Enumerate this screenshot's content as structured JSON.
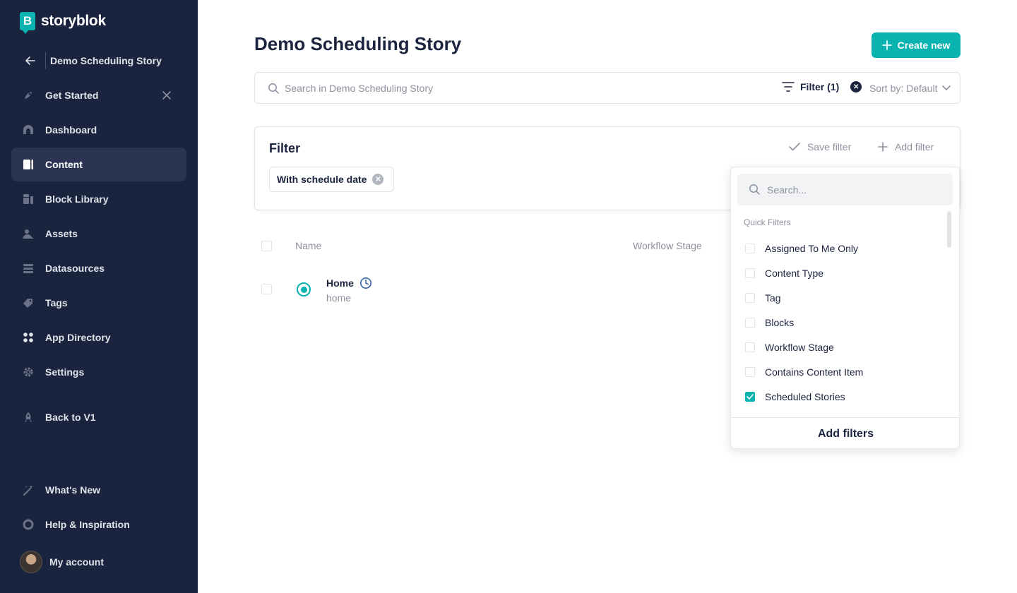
{
  "brand": {
    "logo_letter": "B",
    "name": "storyblok"
  },
  "space": {
    "name": "Demo Scheduling Story"
  },
  "sidebar": {
    "items": [
      {
        "label": "Get Started"
      },
      {
        "label": "Dashboard"
      },
      {
        "label": "Content"
      },
      {
        "label": "Block Library"
      },
      {
        "label": "Assets"
      },
      {
        "label": "Datasources"
      },
      {
        "label": "Tags"
      },
      {
        "label": "App Directory"
      },
      {
        "label": "Settings"
      },
      {
        "label": "Back to V1"
      },
      {
        "label": "What's New"
      },
      {
        "label": "Help & Inspiration"
      }
    ],
    "account_label": "My account"
  },
  "header": {
    "title": "Demo Scheduling Story",
    "create_label": "Create new"
  },
  "search": {
    "placeholder": "Search in Demo Scheduling Story",
    "filter_label": "Filter (1)",
    "sort_label": "Sort by: Default"
  },
  "filter_panel": {
    "title": "Filter",
    "save_label": "Save filter",
    "add_label": "Add filter",
    "active_chip": "With schedule date"
  },
  "table": {
    "columns": [
      "Name",
      "Workflow Stage"
    ],
    "rows": [
      {
        "title": "Home",
        "slug": "home"
      }
    ]
  },
  "dropdown": {
    "search_placeholder": "Search...",
    "section_label": "Quick Filters",
    "options": [
      {
        "label": "Assigned To Me Only",
        "checked": false
      },
      {
        "label": "Content Type",
        "checked": false
      },
      {
        "label": "Tag",
        "checked": false
      },
      {
        "label": "Blocks",
        "checked": false
      },
      {
        "label": "Workflow Stage",
        "checked": false
      },
      {
        "label": "Contains Content Item",
        "checked": false
      },
      {
        "label": "Scheduled Stories",
        "checked": true
      }
    ],
    "footer_label": "Add filters"
  },
  "colors": {
    "sidebar_bg": "#1b243f",
    "accent": "#09b3af",
    "text": "#1b243f",
    "muted": "#8d919f"
  }
}
